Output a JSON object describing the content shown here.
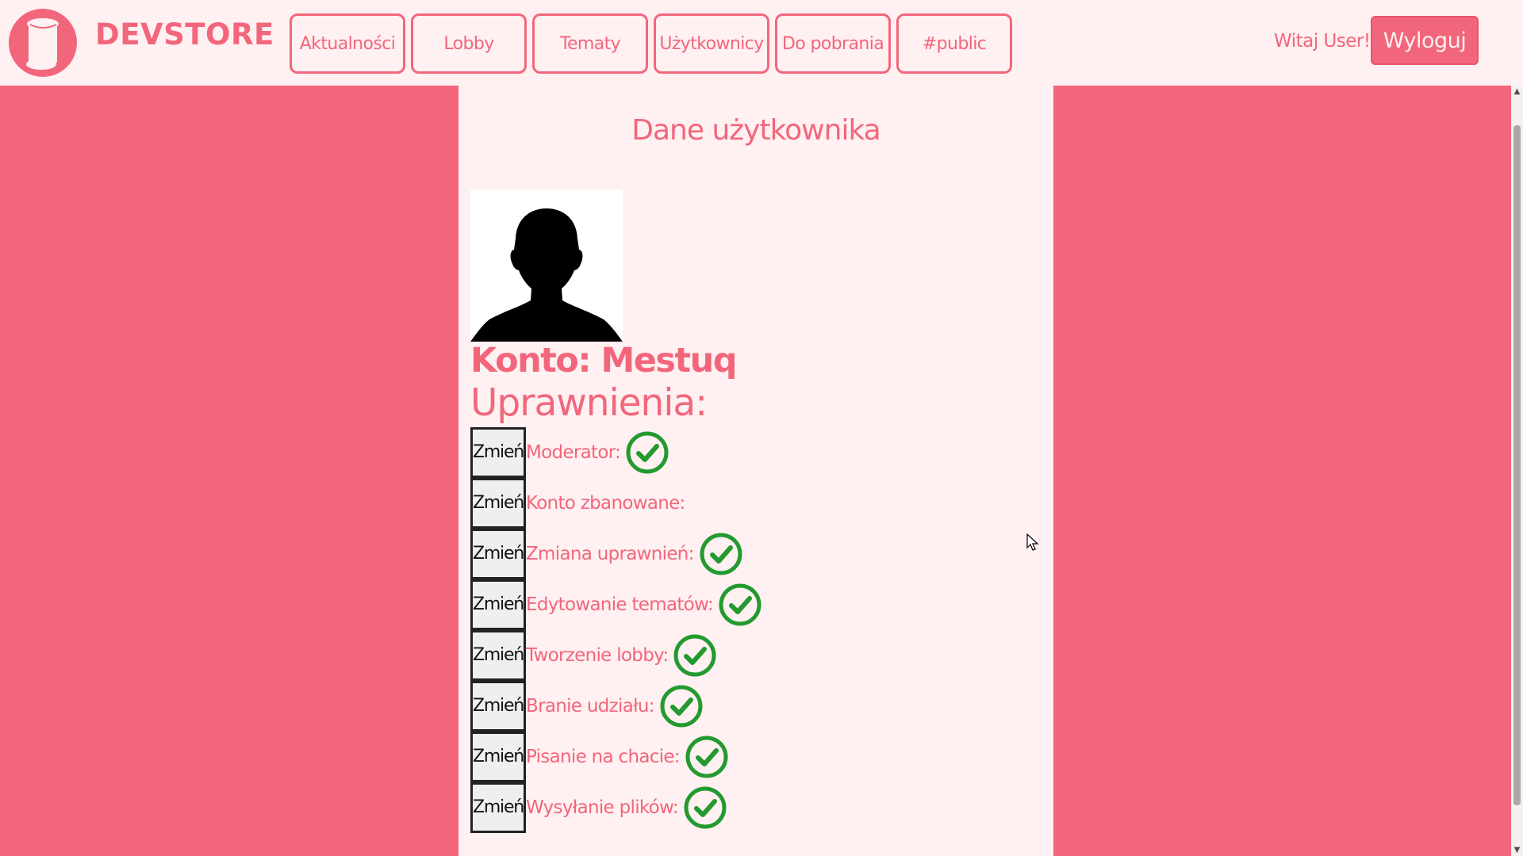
{
  "header": {
    "brand": "DEVSTORE",
    "nav": [
      "Aktualności",
      "Lobby",
      "Tematy",
      "Użytkownicy",
      "Do pobrania",
      "#public"
    ],
    "greeting": "Witaj User!",
    "logout_label": "Wyloguj"
  },
  "panel": {
    "title": "Dane użytkownika",
    "account": "Konto: Mestuq",
    "permissions_heading": "Uprawnienia:",
    "change_label": "Zmień",
    "permissions": [
      {
        "label": "Moderator:",
        "granted": true
      },
      {
        "label": "Konto zbanowane:",
        "granted": false
      },
      {
        "label": "Zmiana uprawnień:",
        "granted": true
      },
      {
        "label": "Edytowanie tematów:",
        "granted": true
      },
      {
        "label": "Tworzenie lobby:",
        "granted": true
      },
      {
        "label": "Branie udziału:",
        "granted": true
      },
      {
        "label": "Pisanie na chacie:",
        "granted": true
      },
      {
        "label": "Wysyłanie plików:",
        "granted": true
      }
    ]
  },
  "icons": {
    "logo": "scroll-logo-icon",
    "avatar": "user-silhouette-icon",
    "granted": "check-circle-icon"
  },
  "colors": {
    "accent": "#f2667c",
    "background": "#fff0f1",
    "check": "#239a2f"
  }
}
